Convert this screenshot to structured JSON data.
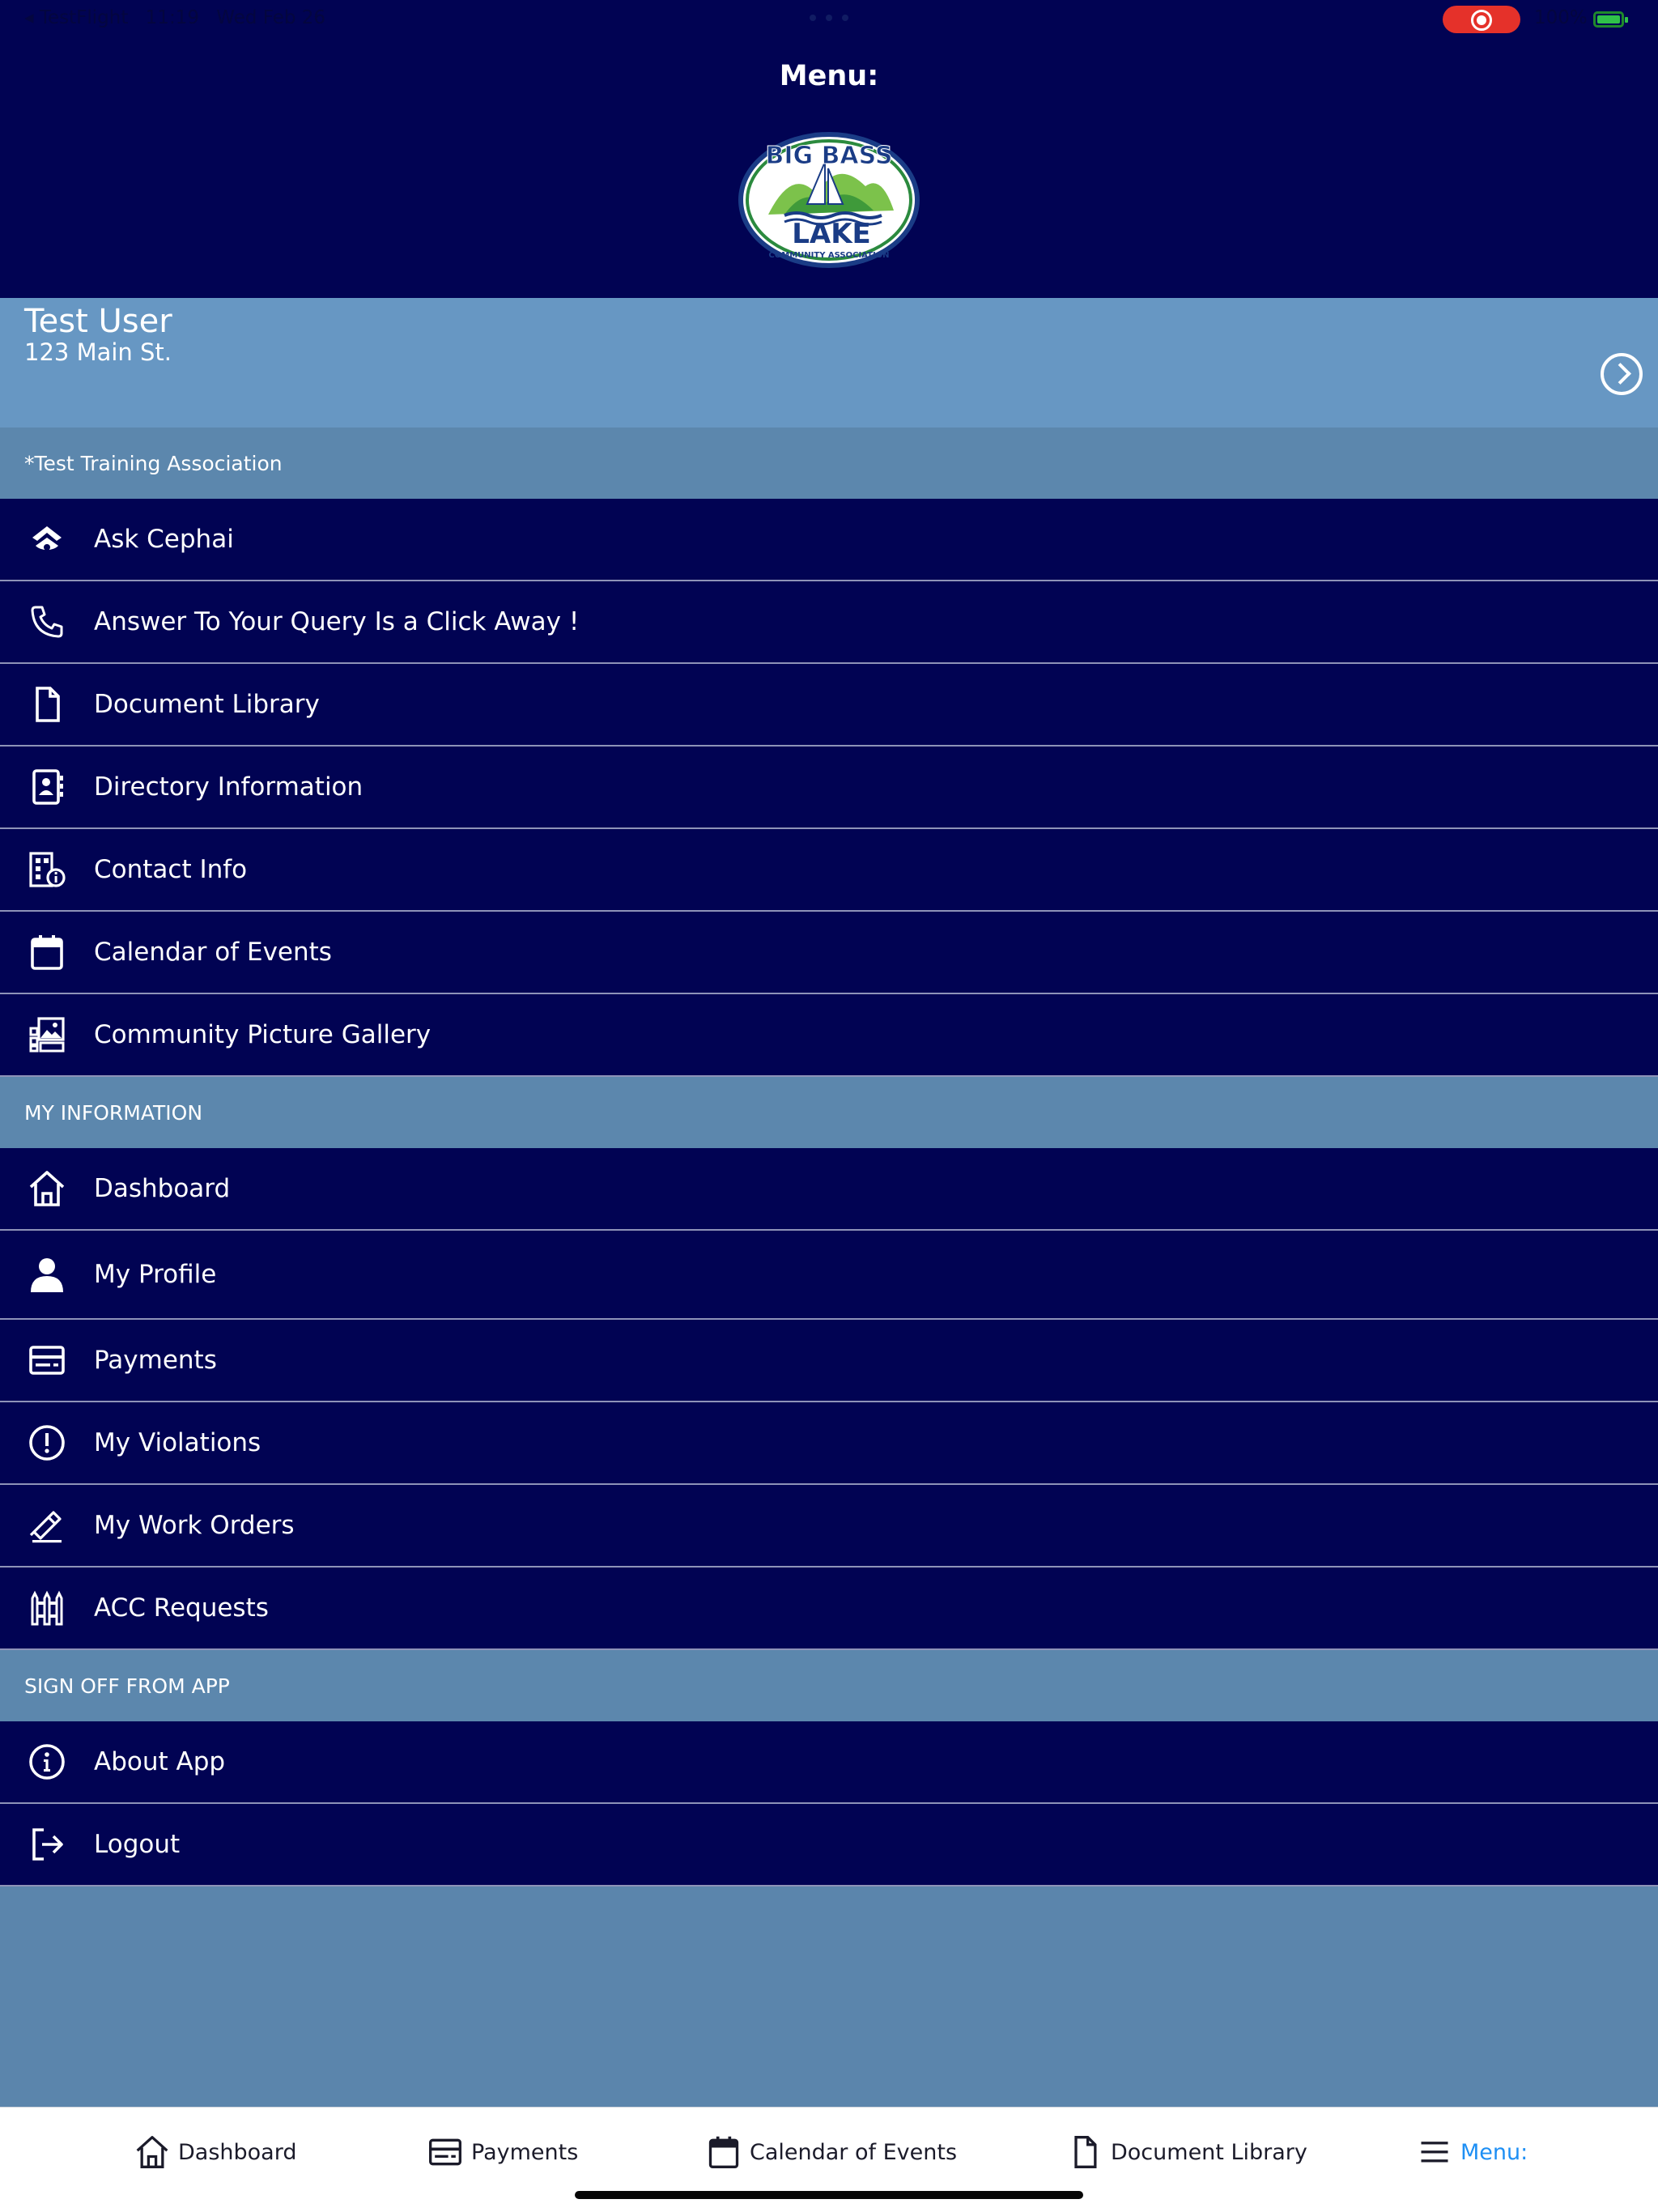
{
  "status_bar": {
    "back_app": "◂ TestFlight",
    "time": "11:19",
    "date": "Wed Feb 26",
    "battery": "100%"
  },
  "header": {
    "title": "Menu:",
    "logo_text_top": "BIG BASS",
    "logo_text_middle": "LAKE",
    "logo_text_bottom": "COMMUNITY ASSOCIATION"
  },
  "user": {
    "name": "Test User",
    "address": "123 Main St."
  },
  "sections": {
    "association": "*Test Training Association",
    "my_information": "MY INFORMATION",
    "sign_off": "SIGN OFF FROM APP"
  },
  "menu": {
    "ask_cephai": "Ask Cephai",
    "answer_query": "Answer To Your Query Is a Click Away !",
    "document_library": "Document Library",
    "directory_information": "Directory Information",
    "contact_info": "Contact Info",
    "calendar_of_events": "Calendar of Events",
    "community_picture_gallery": "Community Picture Gallery",
    "dashboard": "Dashboard",
    "my_profile": "My Profile",
    "payments": "Payments",
    "my_violations": "My Violations",
    "my_work_orders": "My Work Orders",
    "acc_requests": "ACC Requests",
    "about_app": "About App",
    "logout": "Logout"
  },
  "tabbar": {
    "dashboard": "Dashboard",
    "payments": "Payments",
    "calendar": "Calendar of Events",
    "documents": "Document Library",
    "menu": "Menu:"
  },
  "colors": {
    "header_bg": "#010353",
    "row_bg": "#010353",
    "user_card_bg": "#6797c3",
    "section_bg": "#5c87ad",
    "active_tab": "#1e8ff4"
  }
}
